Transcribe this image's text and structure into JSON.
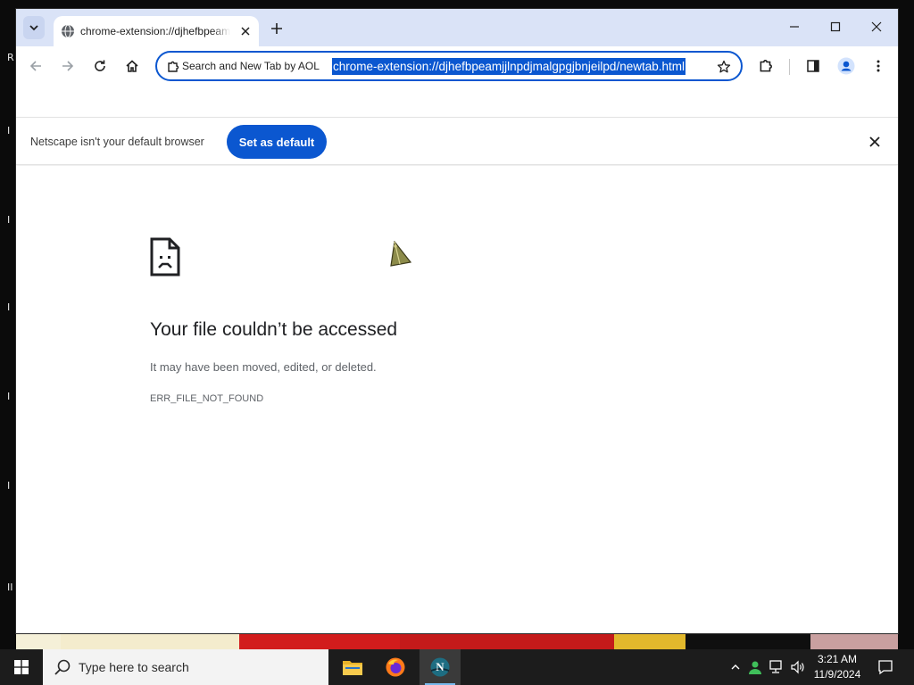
{
  "browser": {
    "tab": {
      "title": "chrome-extension://djhefbpeamjjlnpdjmalgpgjbnjeilpd/newtab.html",
      "favicon": "globe-icon"
    },
    "omnibox": {
      "chip_label": "Search and New Tab by AOL",
      "chip_icon": "puzzle-icon",
      "url": "chrome-extension://djhefbpeamjjlnpdjmalgpgjbnjeilpd/newtab.html"
    },
    "infobar": {
      "message": "Netscape isn't your default browser",
      "button_label": "Set as default"
    }
  },
  "error_page": {
    "title": "Your file couldn’t be accessed",
    "description": "It may have been moved, edited, or deleted.",
    "code": "ERR_FILE_NOT_FOUND"
  },
  "taskbar": {
    "search_placeholder": "Type here to search",
    "clock_time": "3:21 AM",
    "clock_date": "11/9/2024"
  },
  "colors": {
    "accent": "#0b57d0",
    "tabstrip": "#dae3f7",
    "taskbar": "#1c1c1c"
  }
}
